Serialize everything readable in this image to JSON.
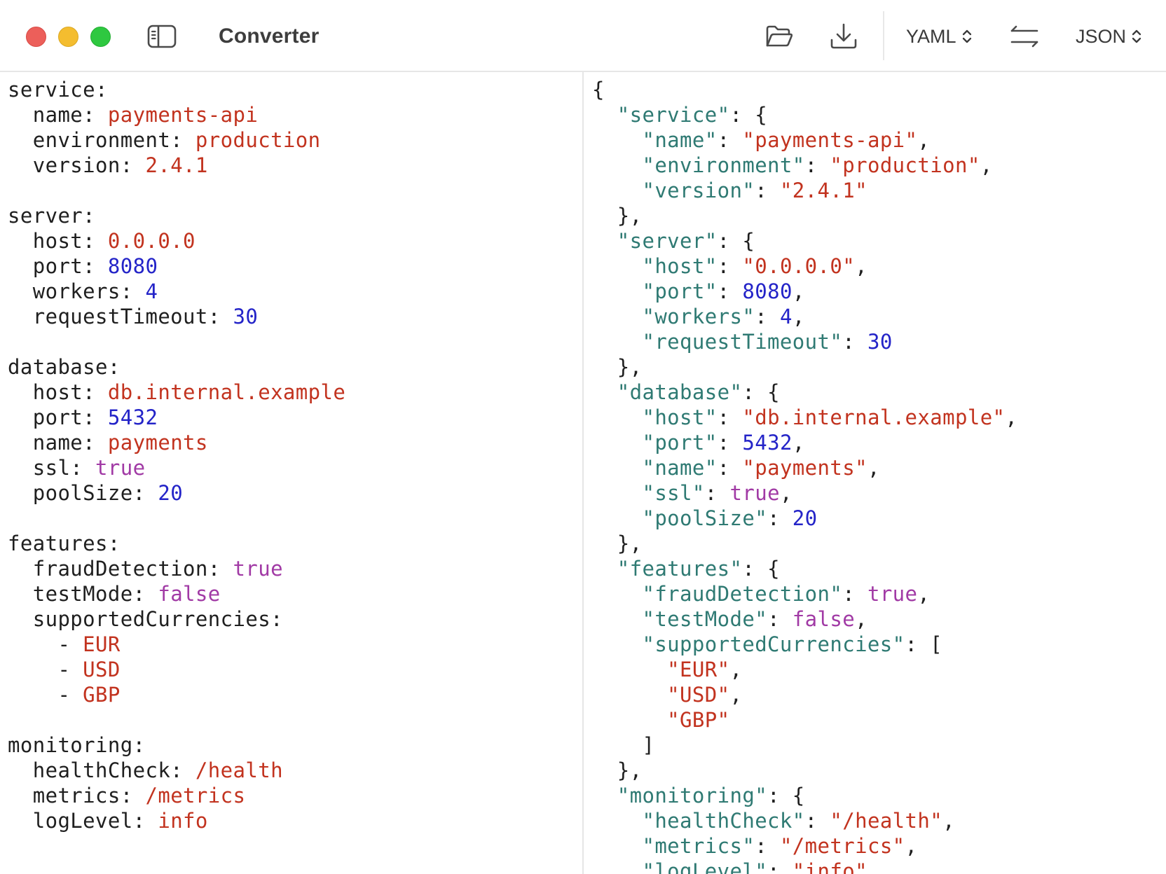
{
  "app": {
    "title": "Converter"
  },
  "toolbar": {
    "source_format": "YAML",
    "target_format": "JSON"
  },
  "colors": {
    "yaml_key": "#1f1f1f",
    "json_key": "#2f7a73",
    "string": "#c2331f",
    "number": "#2424c8",
    "boolean": "#a13aa5"
  },
  "icons": {
    "sidebar_toggle": "sidebar-icon",
    "open": "folder-open-icon",
    "save": "download-icon",
    "swap": "swap-arrows-icon",
    "select": "chevron-up-down-icon"
  },
  "yaml_lines": [
    [
      {
        "t": "key",
        "v": "service:"
      }
    ],
    [
      {
        "t": "key",
        "v": "  name: "
      },
      {
        "t": "str",
        "v": "payments-api"
      }
    ],
    [
      {
        "t": "key",
        "v": "  environment: "
      },
      {
        "t": "str",
        "v": "production"
      }
    ],
    [
      {
        "t": "key",
        "v": "  version: "
      },
      {
        "t": "str",
        "v": "2.4.1"
      }
    ],
    [],
    [
      {
        "t": "key",
        "v": "server:"
      }
    ],
    [
      {
        "t": "key",
        "v": "  host: "
      },
      {
        "t": "str",
        "v": "0.0.0.0"
      }
    ],
    [
      {
        "t": "key",
        "v": "  port: "
      },
      {
        "t": "num",
        "v": "8080"
      }
    ],
    [
      {
        "t": "key",
        "v": "  workers: "
      },
      {
        "t": "num",
        "v": "4"
      }
    ],
    [
      {
        "t": "key",
        "v": "  requestTimeout: "
      },
      {
        "t": "num",
        "v": "30"
      }
    ],
    [],
    [
      {
        "t": "key",
        "v": "database:"
      }
    ],
    [
      {
        "t": "key",
        "v": "  host: "
      },
      {
        "t": "str",
        "v": "db.internal.example"
      }
    ],
    [
      {
        "t": "key",
        "v": "  port: "
      },
      {
        "t": "num",
        "v": "5432"
      }
    ],
    [
      {
        "t": "key",
        "v": "  name: "
      },
      {
        "t": "str",
        "v": "payments"
      }
    ],
    [
      {
        "t": "key",
        "v": "  ssl: "
      },
      {
        "t": "bool",
        "v": "true"
      }
    ],
    [
      {
        "t": "key",
        "v": "  poolSize: "
      },
      {
        "t": "num",
        "v": "20"
      }
    ],
    [],
    [
      {
        "t": "key",
        "v": "features:"
      }
    ],
    [
      {
        "t": "key",
        "v": "  fraudDetection: "
      },
      {
        "t": "bool",
        "v": "true"
      }
    ],
    [
      {
        "t": "key",
        "v": "  testMode: "
      },
      {
        "t": "bool",
        "v": "false"
      }
    ],
    [
      {
        "t": "key",
        "v": "  supportedCurrencies:"
      }
    ],
    [
      {
        "t": "key",
        "v": "    - "
      },
      {
        "t": "str",
        "v": "EUR"
      }
    ],
    [
      {
        "t": "key",
        "v": "    - "
      },
      {
        "t": "str",
        "v": "USD"
      }
    ],
    [
      {
        "t": "key",
        "v": "    - "
      },
      {
        "t": "str",
        "v": "GBP"
      }
    ],
    [],
    [
      {
        "t": "key",
        "v": "monitoring:"
      }
    ],
    [
      {
        "t": "key",
        "v": "  healthCheck: "
      },
      {
        "t": "str",
        "v": "/health"
      }
    ],
    [
      {
        "t": "key",
        "v": "  metrics: "
      },
      {
        "t": "str",
        "v": "/metrics"
      }
    ],
    [
      {
        "t": "key",
        "v": "  logLevel: "
      },
      {
        "t": "str",
        "v": "info"
      }
    ]
  ],
  "json_lines": [
    [
      {
        "t": "punc",
        "v": "{"
      }
    ],
    [
      {
        "t": "punc",
        "v": "  "
      },
      {
        "t": "jkey",
        "v": "\"service\""
      },
      {
        "t": "punc",
        "v": ": {"
      }
    ],
    [
      {
        "t": "punc",
        "v": "    "
      },
      {
        "t": "jkey",
        "v": "\"name\""
      },
      {
        "t": "punc",
        "v": ": "
      },
      {
        "t": "str",
        "v": "\"payments-api\""
      },
      {
        "t": "punc",
        "v": ","
      }
    ],
    [
      {
        "t": "punc",
        "v": "    "
      },
      {
        "t": "jkey",
        "v": "\"environment\""
      },
      {
        "t": "punc",
        "v": ": "
      },
      {
        "t": "str",
        "v": "\"production\""
      },
      {
        "t": "punc",
        "v": ","
      }
    ],
    [
      {
        "t": "punc",
        "v": "    "
      },
      {
        "t": "jkey",
        "v": "\"version\""
      },
      {
        "t": "punc",
        "v": ": "
      },
      {
        "t": "str",
        "v": "\"2.4.1\""
      }
    ],
    [
      {
        "t": "punc",
        "v": "  },"
      }
    ],
    [
      {
        "t": "punc",
        "v": "  "
      },
      {
        "t": "jkey",
        "v": "\"server\""
      },
      {
        "t": "punc",
        "v": ": {"
      }
    ],
    [
      {
        "t": "punc",
        "v": "    "
      },
      {
        "t": "jkey",
        "v": "\"host\""
      },
      {
        "t": "punc",
        "v": ": "
      },
      {
        "t": "str",
        "v": "\"0.0.0.0\""
      },
      {
        "t": "punc",
        "v": ","
      }
    ],
    [
      {
        "t": "punc",
        "v": "    "
      },
      {
        "t": "jkey",
        "v": "\"port\""
      },
      {
        "t": "punc",
        "v": ": "
      },
      {
        "t": "num",
        "v": "8080"
      },
      {
        "t": "punc",
        "v": ","
      }
    ],
    [
      {
        "t": "punc",
        "v": "    "
      },
      {
        "t": "jkey",
        "v": "\"workers\""
      },
      {
        "t": "punc",
        "v": ": "
      },
      {
        "t": "num",
        "v": "4"
      },
      {
        "t": "punc",
        "v": ","
      }
    ],
    [
      {
        "t": "punc",
        "v": "    "
      },
      {
        "t": "jkey",
        "v": "\"requestTimeout\""
      },
      {
        "t": "punc",
        "v": ": "
      },
      {
        "t": "num",
        "v": "30"
      }
    ],
    [
      {
        "t": "punc",
        "v": "  },"
      }
    ],
    [
      {
        "t": "punc",
        "v": "  "
      },
      {
        "t": "jkey",
        "v": "\"database\""
      },
      {
        "t": "punc",
        "v": ": {"
      }
    ],
    [
      {
        "t": "punc",
        "v": "    "
      },
      {
        "t": "jkey",
        "v": "\"host\""
      },
      {
        "t": "punc",
        "v": ": "
      },
      {
        "t": "str",
        "v": "\"db.internal.example\""
      },
      {
        "t": "punc",
        "v": ","
      }
    ],
    [
      {
        "t": "punc",
        "v": "    "
      },
      {
        "t": "jkey",
        "v": "\"port\""
      },
      {
        "t": "punc",
        "v": ": "
      },
      {
        "t": "num",
        "v": "5432"
      },
      {
        "t": "punc",
        "v": ","
      }
    ],
    [
      {
        "t": "punc",
        "v": "    "
      },
      {
        "t": "jkey",
        "v": "\"name\""
      },
      {
        "t": "punc",
        "v": ": "
      },
      {
        "t": "str",
        "v": "\"payments\""
      },
      {
        "t": "punc",
        "v": ","
      }
    ],
    [
      {
        "t": "punc",
        "v": "    "
      },
      {
        "t": "jkey",
        "v": "\"ssl\""
      },
      {
        "t": "punc",
        "v": ": "
      },
      {
        "t": "bool",
        "v": "true"
      },
      {
        "t": "punc",
        "v": ","
      }
    ],
    [
      {
        "t": "punc",
        "v": "    "
      },
      {
        "t": "jkey",
        "v": "\"poolSize\""
      },
      {
        "t": "punc",
        "v": ": "
      },
      {
        "t": "num",
        "v": "20"
      }
    ],
    [
      {
        "t": "punc",
        "v": "  },"
      }
    ],
    [
      {
        "t": "punc",
        "v": "  "
      },
      {
        "t": "jkey",
        "v": "\"features\""
      },
      {
        "t": "punc",
        "v": ": {"
      }
    ],
    [
      {
        "t": "punc",
        "v": "    "
      },
      {
        "t": "jkey",
        "v": "\"fraudDetection\""
      },
      {
        "t": "punc",
        "v": ": "
      },
      {
        "t": "bool",
        "v": "true"
      },
      {
        "t": "punc",
        "v": ","
      }
    ],
    [
      {
        "t": "punc",
        "v": "    "
      },
      {
        "t": "jkey",
        "v": "\"testMode\""
      },
      {
        "t": "punc",
        "v": ": "
      },
      {
        "t": "bool",
        "v": "false"
      },
      {
        "t": "punc",
        "v": ","
      }
    ],
    [
      {
        "t": "punc",
        "v": "    "
      },
      {
        "t": "jkey",
        "v": "\"supportedCurrencies\""
      },
      {
        "t": "punc",
        "v": ": ["
      }
    ],
    [
      {
        "t": "punc",
        "v": "      "
      },
      {
        "t": "str",
        "v": "\"EUR\""
      },
      {
        "t": "punc",
        "v": ","
      }
    ],
    [
      {
        "t": "punc",
        "v": "      "
      },
      {
        "t": "str",
        "v": "\"USD\""
      },
      {
        "t": "punc",
        "v": ","
      }
    ],
    [
      {
        "t": "punc",
        "v": "      "
      },
      {
        "t": "str",
        "v": "\"GBP\""
      }
    ],
    [
      {
        "t": "punc",
        "v": "    ]"
      }
    ],
    [
      {
        "t": "punc",
        "v": "  },"
      }
    ],
    [
      {
        "t": "punc",
        "v": "  "
      },
      {
        "t": "jkey",
        "v": "\"monitoring\""
      },
      {
        "t": "punc",
        "v": ": {"
      }
    ],
    [
      {
        "t": "punc",
        "v": "    "
      },
      {
        "t": "jkey",
        "v": "\"healthCheck\""
      },
      {
        "t": "punc",
        "v": ": "
      },
      {
        "t": "str",
        "v": "\"/health\""
      },
      {
        "t": "punc",
        "v": ","
      }
    ],
    [
      {
        "t": "punc",
        "v": "    "
      },
      {
        "t": "jkey",
        "v": "\"metrics\""
      },
      {
        "t": "punc",
        "v": ": "
      },
      {
        "t": "str",
        "v": "\"/metrics\""
      },
      {
        "t": "punc",
        "v": ","
      }
    ],
    [
      {
        "t": "punc",
        "v": "    "
      },
      {
        "t": "jkey",
        "v": "\"logLevel\""
      },
      {
        "t": "punc",
        "v": ": "
      },
      {
        "t": "str",
        "v": "\"info\""
      }
    ]
  ]
}
